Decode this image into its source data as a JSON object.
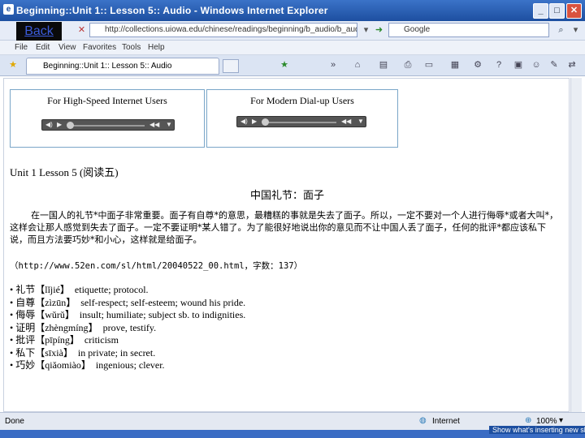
{
  "window": {
    "title": "Beginning::Unit 1:: Lesson 5:: Audio - Windows Internet Explorer"
  },
  "overlay": {
    "back_label": "Back"
  },
  "toolbar": {
    "address": "http://collections.uiowa.edu/chinese/readings/beginning/b_audio/b_audio_u01",
    "search_text": "Google"
  },
  "menu": [
    "File",
    "Edit",
    "View",
    "Favorites",
    "Tools",
    "Help"
  ],
  "tab": {
    "label": "Beginning::Unit 1:: Lesson 5:: Audio"
  },
  "players": [
    {
      "label": "For High-Speed Internet Users"
    },
    {
      "label": "For Modern Dial-up Users"
    }
  ],
  "lesson": {
    "heading": "Unit 1 Lesson 5 (阅读五)",
    "article_title": "中国礼节：面子",
    "body": "在一国人的礼节*中面子非常重要。面子有自尊*的意思，最糟糕的事就是失去了面子。所以，一定不要对一个人进行侮辱*或者大叫*，这样会让那人感觉到失去了面子。一定不要证明*某人错了。为了能很好地说出你的意见而不让中国人丢了面子，任何的批评*都应该私下说，而且方法要巧妙*和小心，这样就是给面子。",
    "source": "（http://www.52en.com/sl/html/20040522_00.html，字数：137）"
  },
  "vocab": [
    {
      "word": "礼节",
      "pinyin": "lǐjié",
      "gloss": "etiquette; protocol."
    },
    {
      "word": "自尊",
      "pinyin": "zìzūn",
      "gloss": "self-respect; self-esteem; wound his pride."
    },
    {
      "word": "侮辱",
      "pinyin": "wǔrǔ",
      "gloss": "insult; humiliate; subject sb. to indignities."
    },
    {
      "word": "证明",
      "pinyin": "zhèngmíng",
      "gloss": "prove, testify."
    },
    {
      "word": "批评",
      "pinyin": "pīpíng",
      "gloss": "criticism"
    },
    {
      "word": "私下",
      "pinyin": "sīxià",
      "gloss": "in private; in secret."
    },
    {
      "word": "巧妙",
      "pinyin": "qiǎomiào",
      "gloss": "ingenious; clever."
    }
  ],
  "status": {
    "left": "Done",
    "zone": "Internet",
    "zoom": "100%"
  },
  "taskbar": {
    "tip": "Show what's inserting new sl"
  }
}
